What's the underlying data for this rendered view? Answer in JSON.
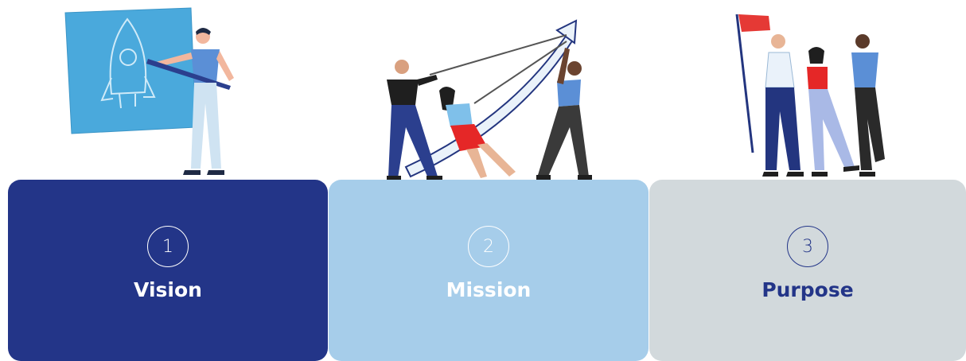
{
  "steps": [
    {
      "number": "1",
      "label": "Vision",
      "illustration": "person-drawing-rocket-blueprint"
    },
    {
      "number": "2",
      "label": "Mission",
      "illustration": "team-pulling-rising-arrow"
    },
    {
      "number": "3",
      "label": "Purpose",
      "illustration": "team-with-red-flag"
    }
  ],
  "colors": {
    "vision_bg": "#233588",
    "vision_text": "#ffffff",
    "mission_bg": "#a6cdea",
    "mission_text": "#ffffff",
    "purpose_bg": "#d2d9dc",
    "purpose_text": "#233588",
    "blueprint": "#4aa9dc",
    "flag": "#e53935"
  }
}
